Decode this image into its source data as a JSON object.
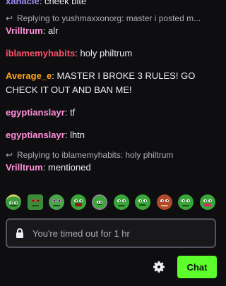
{
  "messages": [
    {
      "type": "message",
      "user": "xanacle",
      "color": "#9f8fff",
      "text": "cheek bite"
    },
    {
      "type": "reply",
      "text": "Replying to yushmaxxonorg: master i posted m..."
    },
    {
      "type": "message",
      "user": "Vrilltrum",
      "color": "#ff8fd9",
      "text": "alr"
    },
    {
      "type": "message",
      "user": "iblamemyhabits",
      "color": "#ff4f6b",
      "text": "holy philtrum"
    },
    {
      "type": "message",
      "user": "Average_e",
      "color": "#ffa31a",
      "text": "MASTER I BROKE 3 RULES! GO CHECK IT OUT AND BAN ME!"
    },
    {
      "type": "message",
      "user": "egyptianslayr",
      "color": "#ff8fd9",
      "text": "tf"
    },
    {
      "type": "message",
      "user": "egyptianslayr",
      "color": "#ff8fd9",
      "text": "lhtn"
    },
    {
      "type": "reply",
      "text": "Replying to iblamemyhabits: holy philtrum"
    },
    {
      "type": "message",
      "user": "Vrilltrum",
      "color": "#ff8fd9",
      "text": "mentioned"
    }
  ],
  "emotes": [
    "peepo-halo-icon",
    "peepo-mad-icon",
    "peepo-glasses-icon",
    "peepo-talk-icon",
    "peepo-headset-icon",
    "peepo-happy-icon",
    "peepo-smile-icon",
    "peepo-monkey-icon",
    "peepo-sad-icon",
    "peepo-heart-icon"
  ],
  "input": {
    "placeholder": "You're timed out for 1 hr"
  },
  "chat_button": {
    "label": "Chat"
  },
  "colors": {
    "accent": "#5cff2b",
    "background": "#0e0e10"
  }
}
